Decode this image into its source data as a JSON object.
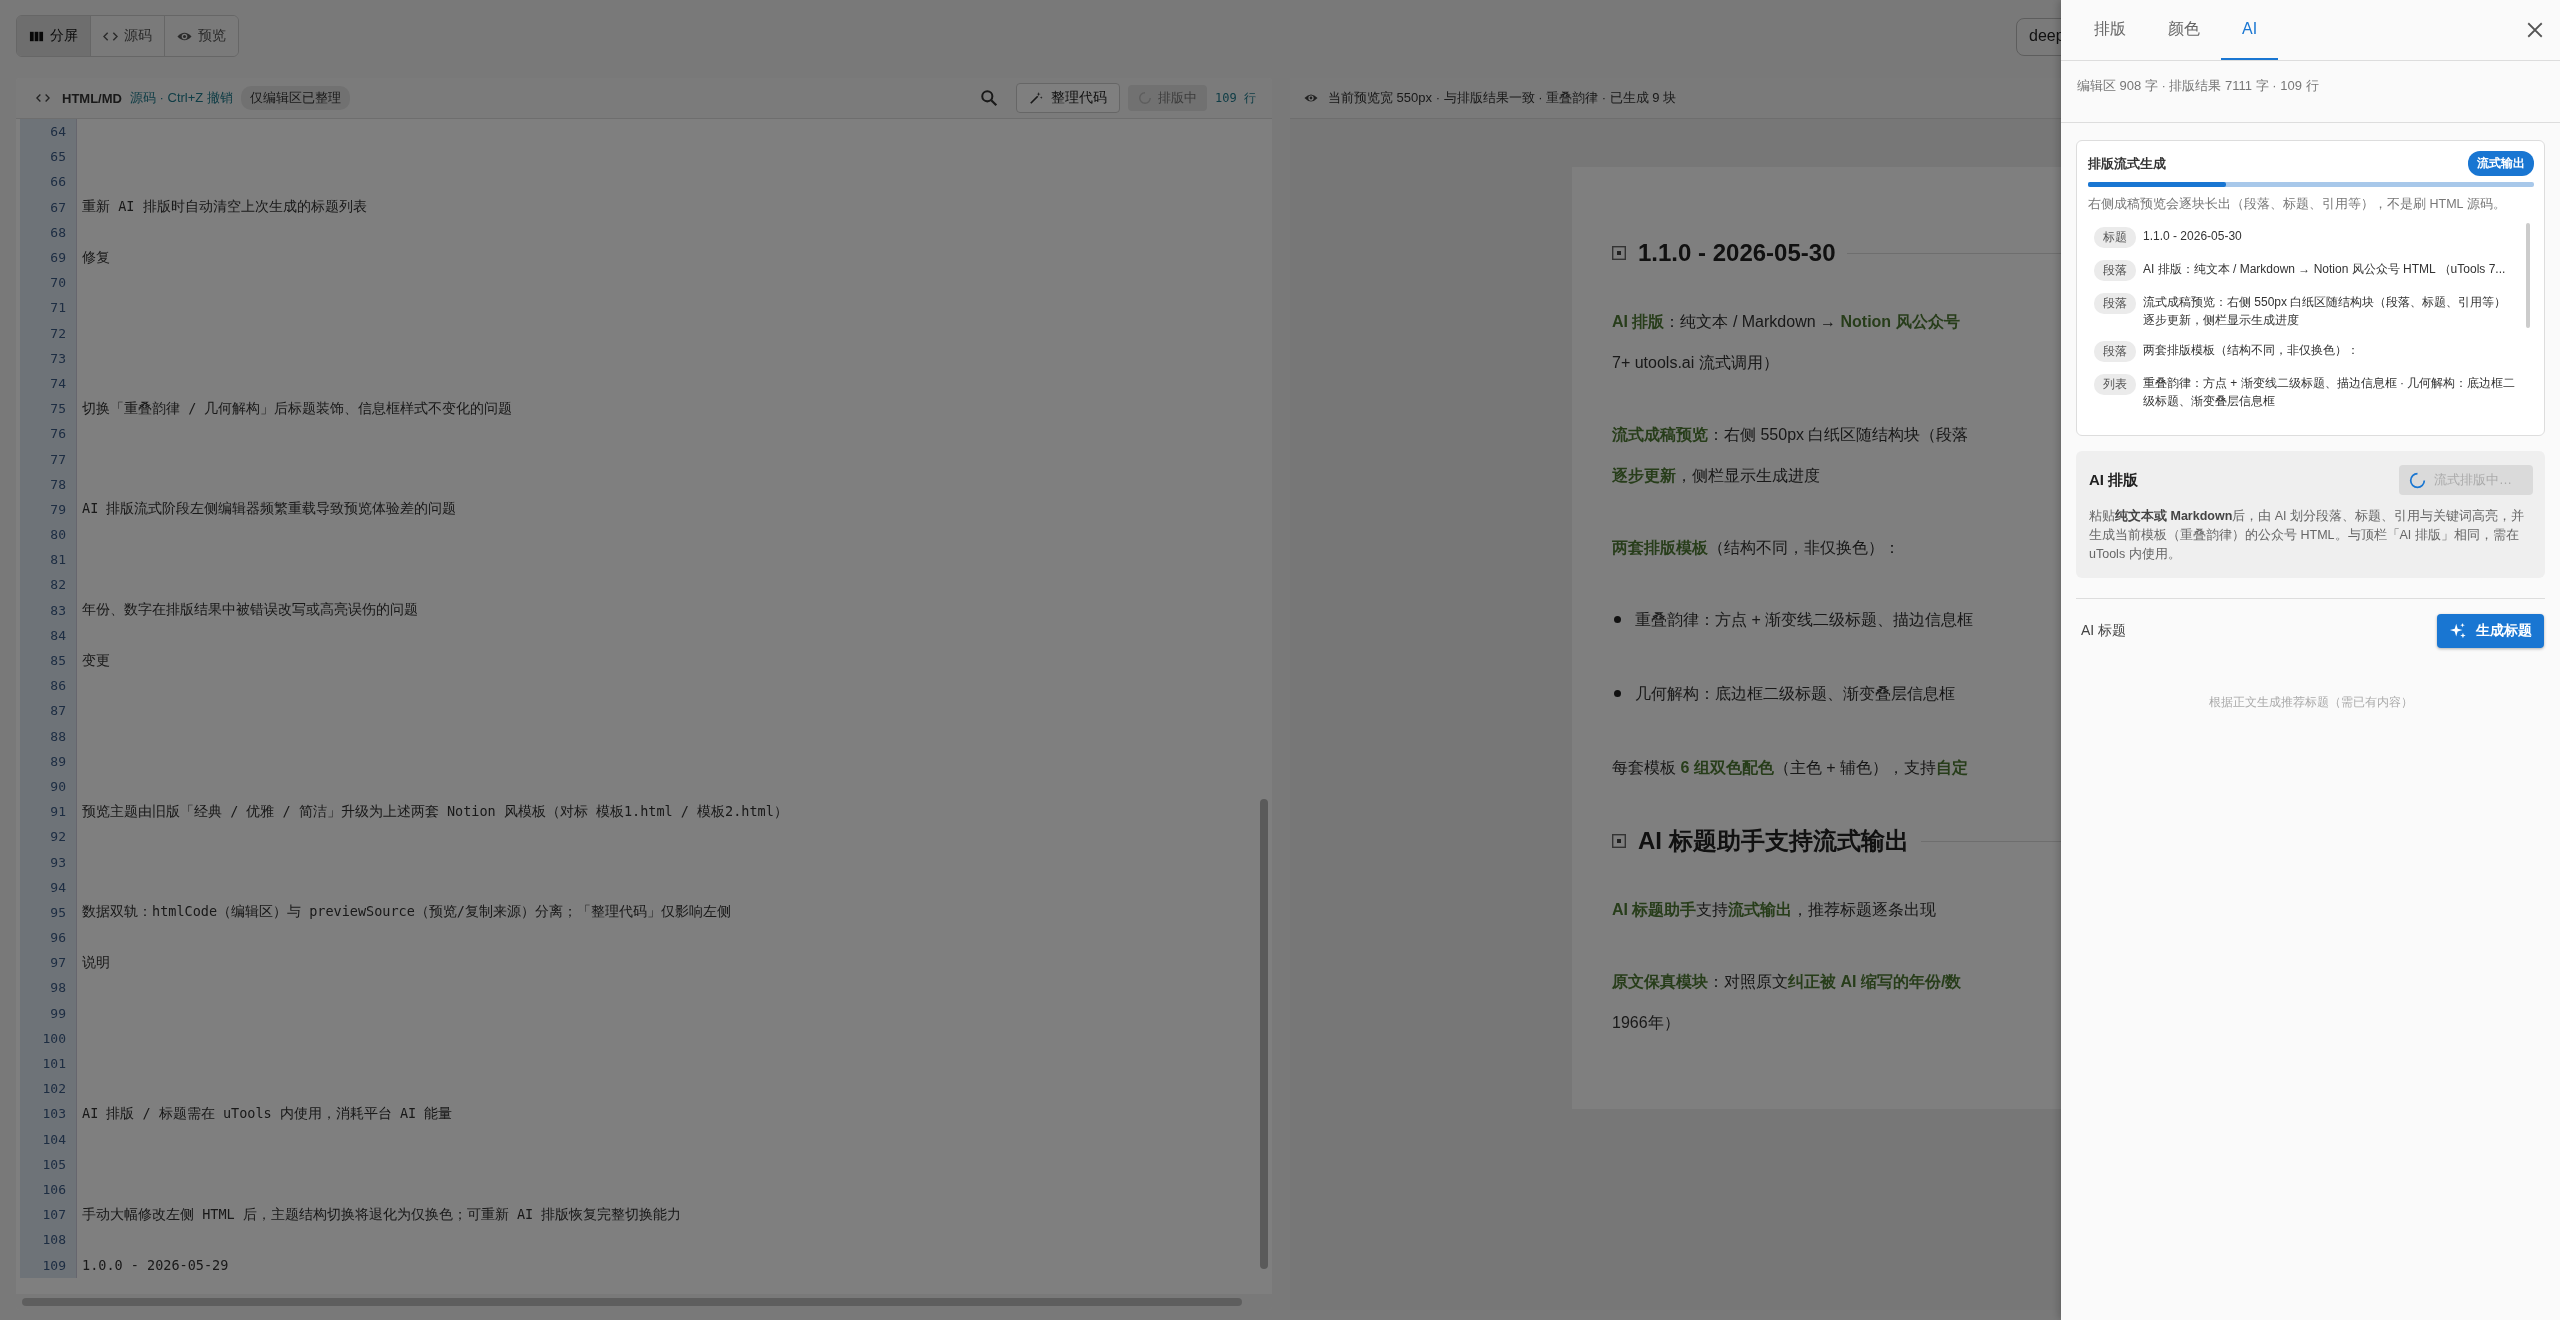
{
  "view_switch": [
    {
      "kind": "split",
      "label": "分屏",
      "selected": true
    },
    {
      "kind": "source",
      "label": "源码",
      "selected": false
    },
    {
      "kind": "preview",
      "label": "预览",
      "selected": false
    }
  ],
  "model_select": {
    "value": "deep"
  },
  "editor": {
    "title": "HTML/MD",
    "mode": "源码 · Ctrl+Z 撤销",
    "badge": "仅编辑区已整理",
    "format_button": "整理代码",
    "busy_button": {
      "label": "排版中",
      "disabled": true
    },
    "line_count": "109 行",
    "lines": [
      {
        "number": "64"
      },
      {
        "number": "65"
      },
      {
        "number": "66"
      },
      {
        "number": "67",
        "text": "重新 AI 排版时自动清空上次生成的标题列表"
      },
      {
        "number": "68"
      },
      {
        "number": "69",
        "text": "修复"
      },
      {
        "number": "70"
      },
      {
        "number": "71"
      },
      {
        "number": "72"
      },
      {
        "number": "73"
      },
      {
        "number": "74"
      },
      {
        "number": "75",
        "text": "切换「重叠韵律 / 几何解构」后标题装饰、信息框样式不变化的问题"
      },
      {
        "number": "76"
      },
      {
        "number": "77"
      },
      {
        "number": "78"
      },
      {
        "number": "79",
        "text": "AI 排版流式阶段左侧编辑器频繁重载导致预览体验差的问题"
      },
      {
        "number": "80"
      },
      {
        "number": "81"
      },
      {
        "number": "82"
      },
      {
        "number": "83",
        "text": "年份、数字在排版结果中被错误改写或高亮误伤的问题"
      },
      {
        "number": "84"
      },
      {
        "number": "85",
        "text": "变更"
      },
      {
        "number": "86"
      },
      {
        "number": "87"
      },
      {
        "number": "88"
      },
      {
        "number": "89"
      },
      {
        "number": "90"
      },
      {
        "number": "91",
        "text": "预览主题由旧版「经典 / 优雅 / 简洁」升级为上述两套 Notion 风模板（对标 模板1.html / 模板2.html）"
      },
      {
        "number": "92"
      },
      {
        "number": "93"
      },
      {
        "number": "94"
      },
      {
        "number": "95",
        "text": "数据双轨：htmlCode（编辑区）与 previewSource（预览/复制来源）分离；「整理代码」仅影响左侧"
      },
      {
        "number": "96"
      },
      {
        "number": "97",
        "text": "说明"
      },
      {
        "number": "98"
      },
      {
        "number": "99"
      },
      {
        "number": "100"
      },
      {
        "number": "101"
      },
      {
        "number": "102"
      },
      {
        "number": "103",
        "text": "AI 排版 / 标题需在 uTools 内使用，消耗平台 AI 能量"
      },
      {
        "number": "104"
      },
      {
        "number": "105"
      },
      {
        "number": "106"
      },
      {
        "number": "107",
        "text": "手动大幅修改左侧 HTML 后，主题结构切换将退化为仅换色；可重新 AI 排版恢复完整切换能力"
      },
      {
        "number": "108"
      },
      {
        "number": "109",
        "text": "1.0.0 - 2026-05-29"
      }
    ]
  },
  "preview": {
    "status": "当前预览宽 550px · 与排版结果一致 · 重叠韵律 · 已生成 9 块",
    "blocks": [
      {
        "kind": "heading",
        "text": "1.1.0 - 2026-05-30"
      },
      {
        "kind": "paragraph",
        "lines": [
          "**AI 排版**：纯文本 / Markdown → **Notion 风公众号**",
          "7+ utools.ai 流式调用）"
        ]
      },
      {
        "kind": "paragraph",
        "lines": [
          "**流式成稿预览**：右侧 550px 白纸区随结构块（段落",
          "**逐步更新**，侧栏显示生成进度"
        ]
      },
      {
        "kind": "paragraph",
        "lines": [
          "**两套排版模板**（结构不同，非仅换色）："
        ]
      },
      {
        "kind": "bullet",
        "lines": [
          "重叠韵律：方点 + 渐变线二级标题、描边信息框"
        ]
      },
      {
        "kind": "bullet",
        "lines": [
          "几何解构：底边框二级标题、渐变叠层信息框"
        ]
      },
      {
        "kind": "paragraph",
        "lines": [
          "每套模板 **6 组双色配色**（主色 + 辅色），支持**自定**"
        ]
      },
      {
        "kind": "heading",
        "text": "AI 标题助手支持流式输出"
      },
      {
        "kind": "paragraph",
        "lines": [
          "**AI 标题助手**支持**流式输出**，推荐标题逐条出现"
        ]
      },
      {
        "kind": "paragraph",
        "lines": [
          "**原文保真模块**：对照原文**纠正被 AI 缩写的年份/数**",
          "1966年）"
        ]
      }
    ]
  },
  "drawer": {
    "tabs": [
      {
        "label": "排版",
        "selected": false
      },
      {
        "label": "颜色",
        "selected": false
      },
      {
        "label": "AI",
        "selected": true
      }
    ],
    "stats": "编辑区 908 字 · 排版结果 7111 字 · 109 行",
    "stream_card": {
      "title": "排版流式生成",
      "badge": "流式输出",
      "level": 0.31,
      "note": "右侧成稿预览会逐块长出（段落、标题、引用等），不是刷 HTML 源码。",
      "items": [
        {
          "tag": "标题",
          "text": "1.1.0 - 2026-05-30"
        },
        {
          "tag": "段落",
          "text": "AI 排版：纯文本 / Markdown → Notion 风公众号 HTML （uTools 7..."
        },
        {
          "tag": "段落",
          "text": "流式成稿预览：右侧 550px 白纸区随结构块（段落、标题、引用等）逐步更新，侧栏显示生成进度"
        },
        {
          "tag": "段落",
          "text": "两套排版模板（结构不同，非仅换色）："
        },
        {
          "tag": "列表",
          "text": "重叠韵律：方点 + 渐变线二级标题、描边信息框 · 几何解构：底边框二级标题、渐变叠层信息框"
        }
      ]
    },
    "ai_layout": {
      "title": "AI 排版",
      "button": {
        "label": "流式排版中…",
        "disabled": true
      },
      "description": "粘贴**纯文本或 Markdown**后，由 AI 划分段落、标题、引用与关键词高亮，并生成当前模板（重叠韵律）的公众号 HTML。与顶栏「AI 排版」相同，需在 uTools 内使用。"
    },
    "ai_title": {
      "label": "AI 标题",
      "button": "生成标题",
      "hint": "根据正文生成推荐标题（需已有内容）"
    }
  }
}
